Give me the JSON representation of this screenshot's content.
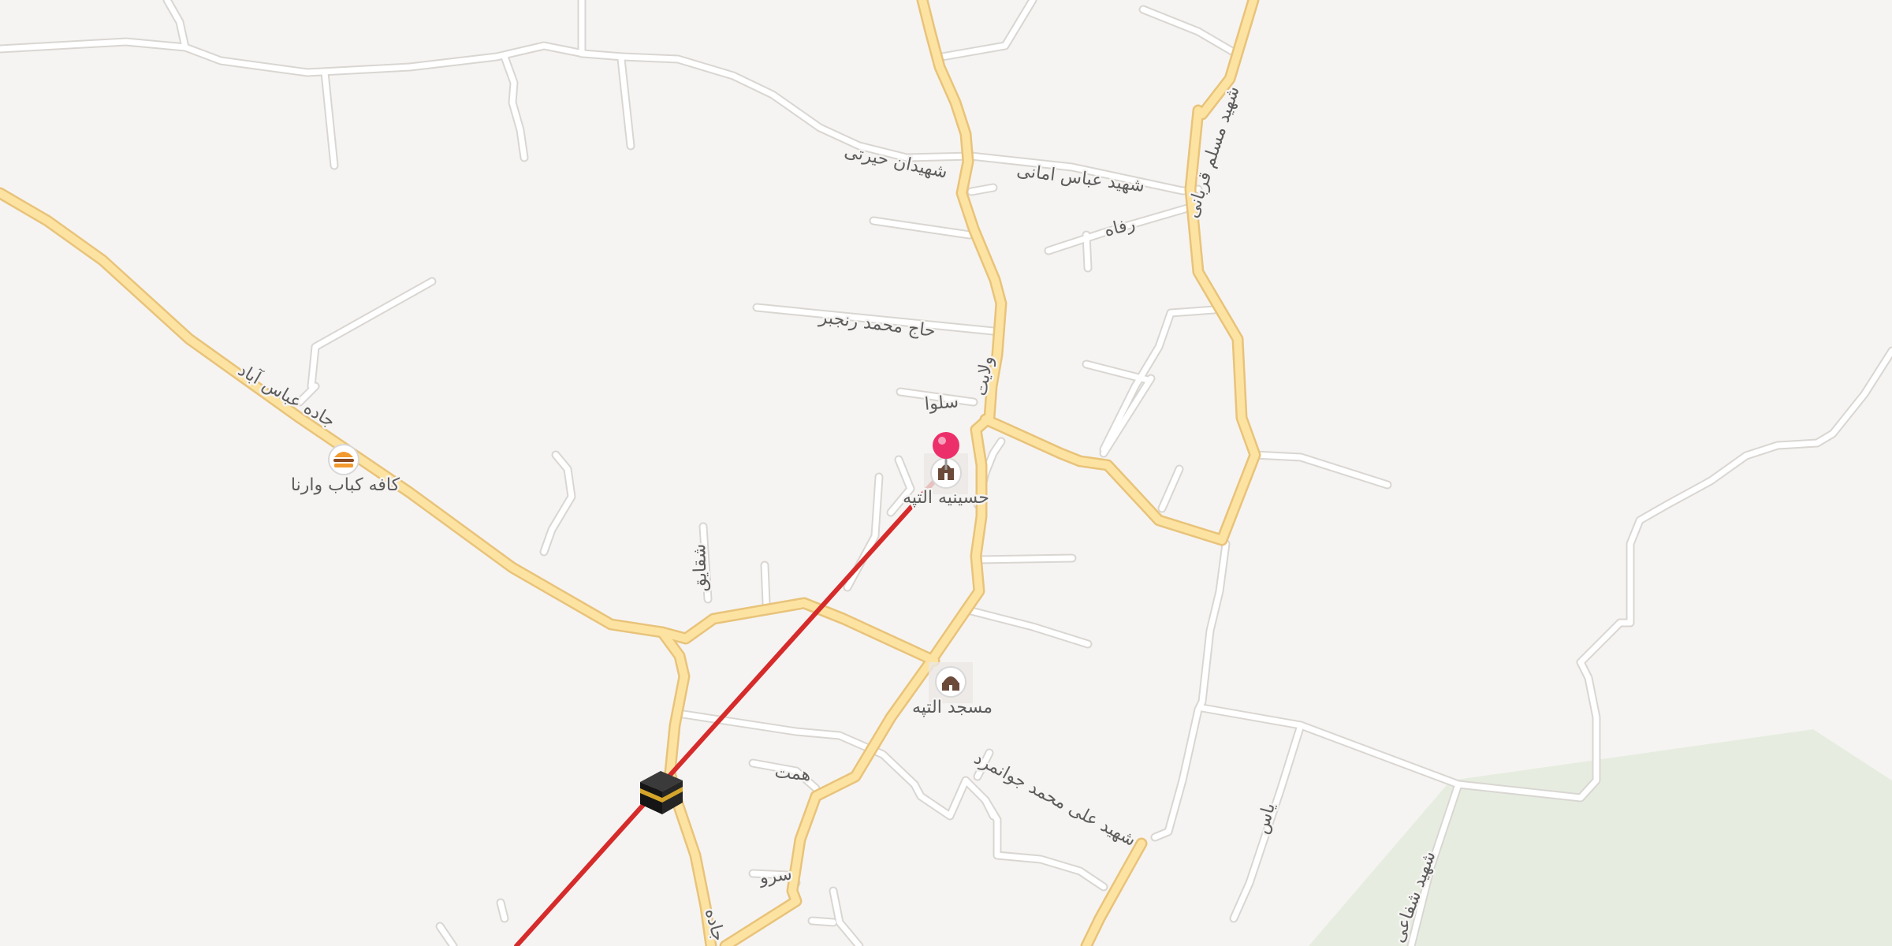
{
  "map": {
    "colors": {
      "background": "#f6f4f2",
      "minor_road": "#ffffff",
      "minor_road_casing": "#d9d6d2",
      "major_road": "#fde3a1",
      "major_road_casing": "#e8c37a",
      "park": "#e6ede0",
      "qibla_line": "#d62b2b",
      "pin": "#ec2f6a"
    },
    "street_labels": [
      "شهیدان حیرتی",
      "شهید عباس امانی",
      "رفاه",
      "شهید مسلم قربانی",
      "حاج محمد رنجبر",
      "ولایت",
      "سلوا",
      "جاده عباس آباد",
      "شقایق",
      "همت",
      "شهید علی محمد جوانمرد",
      "سرو",
      "جاده",
      "یاس",
      "شهید شفاعی"
    ],
    "places": [
      {
        "name": "کافه کباب وارنا",
        "icon": "burger-icon"
      },
      {
        "name": "حسینیه التپه",
        "icon": "shrine-icon"
      },
      {
        "name": "مسجد التپه",
        "icon": "mosque-icon"
      }
    ],
    "markers": [
      {
        "name": "selected-location",
        "icon": "map-pin-icon"
      },
      {
        "name": "qibla",
        "icon": "kaaba-icon"
      }
    ]
  }
}
